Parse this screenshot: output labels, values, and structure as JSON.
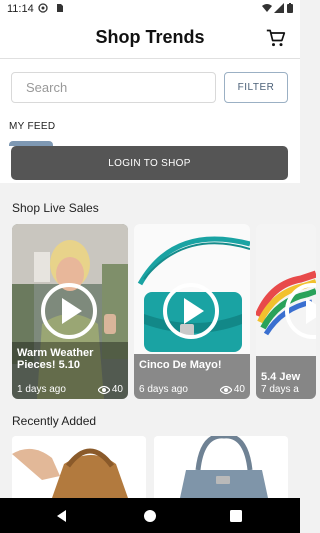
{
  "status_bar": {
    "time": "11:14"
  },
  "header": {
    "title": "Shop Trends"
  },
  "search": {
    "placeholder": "Search",
    "value": ""
  },
  "filter_label": "FILTER",
  "feed_tab_label": "MY FEED",
  "login_label": "LOGIN TO SHOP",
  "live_section_title": "Shop Live Sales",
  "live_cards": [
    {
      "title": "Warm Weather Pieces! 5.10",
      "age": "1 days ago",
      "views": "40"
    },
    {
      "title": "Cinco De Mayo!",
      "age": "6 days ago",
      "views": "40"
    },
    {
      "title": "5.4 Jew",
      "age": "7 days a",
      "views": ""
    }
  ],
  "recent_section_title": "Recently Added",
  "colors": {
    "accent": "#7e98b3",
    "login_button": "#555555",
    "teal_product": "#1aa3a3"
  }
}
